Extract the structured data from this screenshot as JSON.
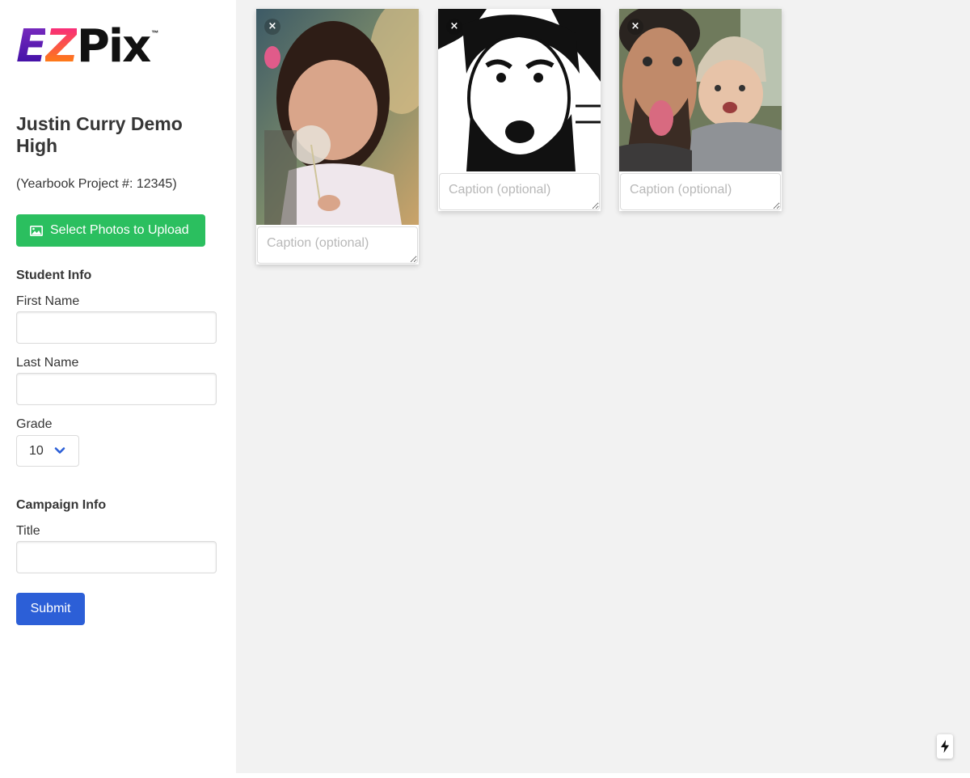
{
  "brand": {
    "logo_e": "E",
    "logo_z": "Z",
    "logo_pix": "Pix",
    "logo_tm": "™"
  },
  "school_name": "Justin Curry Demo High",
  "project_label": "(Yearbook Project #: 12345)",
  "upload_button": {
    "label": "Select Photos to Upload",
    "icon": "image-icon",
    "color": "#2bbf5f"
  },
  "student_info": {
    "title": "Student Info",
    "first_name_label": "First Name",
    "first_name_value": "",
    "last_name_label": "Last Name",
    "last_name_value": "",
    "grade_label": "Grade",
    "grade_value": "10"
  },
  "campaign_info": {
    "title": "Campaign Info",
    "title_label": "Title",
    "title_value": ""
  },
  "submit_button": {
    "label": "Submit",
    "color": "#2c5fd7"
  },
  "photos": [
    {
      "caption_placeholder": "Caption (optional)",
      "remove_label": "×"
    },
    {
      "caption_placeholder": "Caption (optional)",
      "remove_label": "×"
    },
    {
      "caption_placeholder": "Caption (optional)",
      "remove_label": "×"
    }
  ],
  "colors": {
    "main_bg": "#f2f2f2",
    "sidebar_bg": "#ffffff"
  }
}
